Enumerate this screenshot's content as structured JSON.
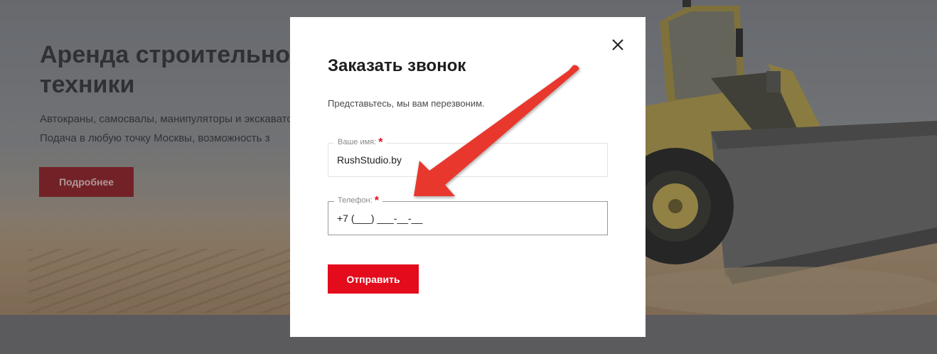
{
  "hero": {
    "title": "Аренда строительной техники",
    "subtitle_line1": "Автокраны, самосвалы, манипуляторы и экскаваторы.",
    "subtitle_line2": "Подача в любую точку Москвы, возможность з",
    "button_label": "Подробнее"
  },
  "modal": {
    "title": "Заказать звонок",
    "description": "Представьтесь, мы вам перезвоним.",
    "name_field": {
      "label": "Ваше имя:",
      "required_mark": "*",
      "value": "RushStudio.by"
    },
    "phone_field": {
      "label": "Телефон:",
      "required_mark": "*",
      "value": "+7 (___) ___-__-__"
    },
    "submit_label": "Отправить",
    "close_icon": "close-icon"
  },
  "colors": {
    "accent_red": "#e30b1c",
    "annotation_arrow": "#e8372f"
  }
}
